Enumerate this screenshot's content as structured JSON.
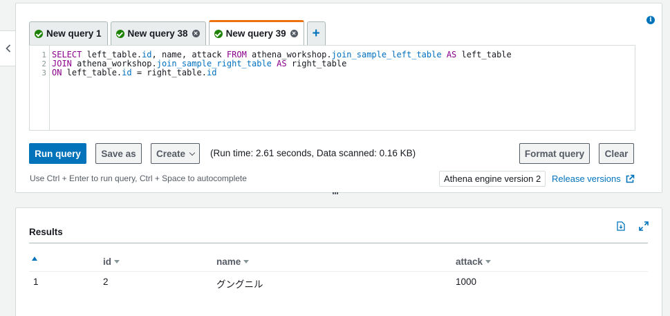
{
  "tabs": [
    {
      "label": "New query 1",
      "active": false,
      "closable": false
    },
    {
      "label": "New query 38",
      "active": false,
      "closable": true
    },
    {
      "label": "New query 39",
      "active": true,
      "closable": true
    }
  ],
  "add_tab_label": "+",
  "editor": {
    "lines": [
      {
        "no": "1",
        "segments": [
          {
            "t": "SELECT",
            "c": "kw"
          },
          {
            "t": " left_table.",
            "c": ""
          },
          {
            "t": "id",
            "c": "prop"
          },
          {
            "t": ", name, attack ",
            "c": ""
          },
          {
            "t": "FROM",
            "c": "kw"
          },
          {
            "t": " athena_workshop.",
            "c": ""
          },
          {
            "t": "join_sample_left_table",
            "c": "prop"
          },
          {
            "t": " ",
            "c": ""
          },
          {
            "t": "AS",
            "c": "kw"
          },
          {
            "t": " left_table",
            "c": ""
          }
        ]
      },
      {
        "no": "2",
        "segments": [
          {
            "t": "JOIN",
            "c": "kw"
          },
          {
            "t": " athena_workshop.",
            "c": ""
          },
          {
            "t": "join_sample_right_table",
            "c": "prop"
          },
          {
            "t": " ",
            "c": ""
          },
          {
            "t": "AS",
            "c": "kw"
          },
          {
            "t": " right_table",
            "c": ""
          }
        ]
      },
      {
        "no": "3",
        "segments": [
          {
            "t": "ON",
            "c": "kw"
          },
          {
            "t": " left_table.",
            "c": ""
          },
          {
            "t": "id",
            "c": "prop"
          },
          {
            "t": " = right_table.",
            "c": ""
          },
          {
            "t": "id",
            "c": "prop"
          }
        ]
      }
    ]
  },
  "actions": {
    "run": "Run query",
    "save_as": "Save as",
    "create": "Create",
    "run_stats": "(Run time: 2.61 seconds, Data scanned: 0.16 KB)",
    "format": "Format query",
    "clear": "Clear"
  },
  "hint": "Use Ctrl + Enter to run query, Ctrl + Space to autocomplete",
  "engine_badge": "Athena engine version 2",
  "release_link": "Release versions",
  "results": {
    "title": "Results",
    "columns": [
      "id",
      "name",
      "attack"
    ],
    "rows": [
      {
        "row_no": "1",
        "cells": [
          "2",
          "グングニル",
          "1000"
        ]
      }
    ]
  },
  "colors": {
    "accent": "#0073bb",
    "active_tab": "#ec7211",
    "success": "#1d8102"
  }
}
